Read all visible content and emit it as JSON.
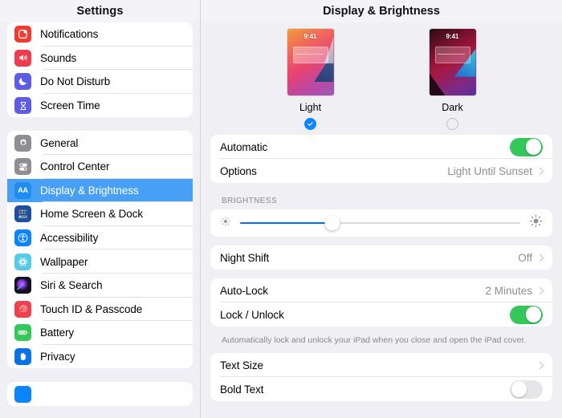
{
  "sidebar": {
    "title": "Settings",
    "groups": [
      {
        "items": [
          {
            "label": "Notifications",
            "icon": "notifications-icon"
          },
          {
            "label": "Sounds",
            "icon": "sounds-icon"
          },
          {
            "label": "Do Not Disturb",
            "icon": "do-not-disturb-icon"
          },
          {
            "label": "Screen Time",
            "icon": "screen-time-icon"
          }
        ]
      },
      {
        "items": [
          {
            "label": "General",
            "icon": "gear-icon"
          },
          {
            "label": "Control Center",
            "icon": "control-center-icon"
          },
          {
            "label": "Display & Brightness",
            "icon": "display-brightness-icon"
          },
          {
            "label": "Home Screen & Dock",
            "icon": "home-screen-icon"
          },
          {
            "label": "Accessibility",
            "icon": "accessibility-icon"
          },
          {
            "label": "Wallpaper",
            "icon": "wallpaper-icon"
          },
          {
            "label": "Siri & Search",
            "icon": "siri-icon"
          },
          {
            "label": "Touch ID & Passcode",
            "icon": "touch-id-icon"
          },
          {
            "label": "Battery",
            "icon": "battery-icon"
          },
          {
            "label": "Privacy",
            "icon": "privacy-icon"
          }
        ]
      }
    ],
    "selected_label": "Display & Brightness"
  },
  "main": {
    "title": "Display & Brightness",
    "appearance": {
      "light": {
        "name": "Light",
        "time": "9:41",
        "selected": true
      },
      "dark": {
        "name": "Dark",
        "time": "9:41",
        "selected": false
      }
    },
    "automatic": {
      "label": "Automatic",
      "enabled": true
    },
    "options": {
      "label": "Options",
      "value": "Light Until Sunset"
    },
    "brightness": {
      "section_label": "BRIGHTNESS",
      "value_percent": 33
    },
    "night_shift": {
      "label": "Night Shift",
      "value": "Off"
    },
    "auto_lock": {
      "label": "Auto-Lock",
      "value": "2 Minutes"
    },
    "lock_unlock": {
      "label": "Lock / Unlock",
      "enabled": true
    },
    "lock_note": "Automatically lock and unlock your iPad when you close and open the iPad cover.",
    "text_size": {
      "label": "Text Size"
    },
    "bold_text": {
      "label": "Bold Text",
      "enabled": false
    }
  },
  "annotation": {
    "arrow_color": "#ee1b24",
    "points_at": "Automatic toggle"
  }
}
